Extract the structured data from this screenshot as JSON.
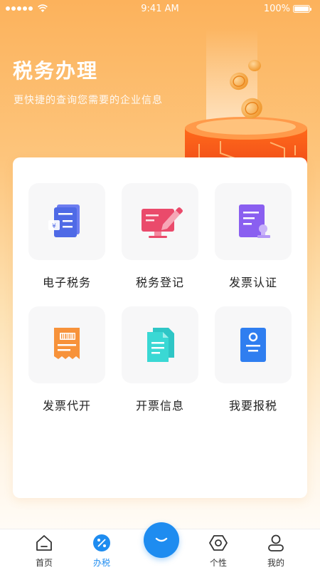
{
  "status_bar": {
    "time": "9:41 AM",
    "battery": "100%",
    "signal_icon": "signal-dots-icon",
    "wifi_icon": "wifi-icon",
    "battery_icon": "battery-icon"
  },
  "header": {
    "title": "税务办理",
    "subtitle": "更快捷的查询您需要的企业信息"
  },
  "services": [
    {
      "label": "电子税务",
      "icon": "tax-documents-icon"
    },
    {
      "label": "税务登记",
      "icon": "monitor-pen-icon"
    },
    {
      "label": "发票认证",
      "icon": "certified-document-icon"
    },
    {
      "label": "发票代开",
      "icon": "receipt-icon"
    },
    {
      "label": "开票信息",
      "icon": "invoice-files-icon"
    },
    {
      "label": "我要报税",
      "icon": "tax-report-icon"
    }
  ],
  "tabbar": {
    "items": [
      {
        "label": "首页",
        "icon": "home-icon"
      },
      {
        "label": "办税",
        "icon": "percent-icon"
      },
      {
        "label": "个性",
        "icon": "hexagon-icon"
      },
      {
        "label": "我的",
        "icon": "user-icon"
      }
    ],
    "active_index": 1,
    "center_icon": "chat-icon"
  },
  "colors": {
    "accent": "#1e8cf0",
    "header_gradient_top": "#fcb25c"
  }
}
